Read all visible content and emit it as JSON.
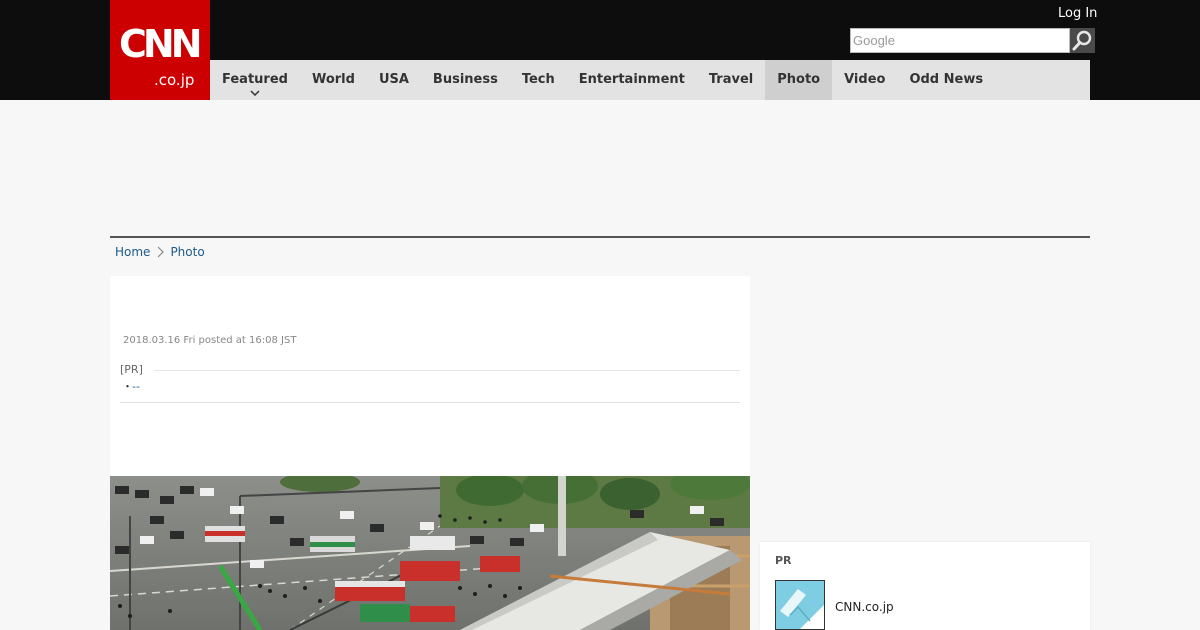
{
  "header": {
    "logo_main": "CNN",
    "logo_sub": ".co.jp",
    "login_label": "Log In",
    "search_placeholder": "Google"
  },
  "nav": {
    "items": [
      {
        "label": "Featured"
      },
      {
        "label": "World"
      },
      {
        "label": "USA"
      },
      {
        "label": "Business"
      },
      {
        "label": "Tech"
      },
      {
        "label": "Entertainment"
      },
      {
        "label": "Travel"
      },
      {
        "label": "Photo"
      },
      {
        "label": "Video"
      },
      {
        "label": "Odd News"
      }
    ],
    "active": "Photo"
  },
  "breadcrumb": {
    "home": "Home",
    "current": "Photo"
  },
  "article": {
    "timestamp": "2018.03.16 Fri posted at 16:08 JST",
    "pr_label": "[PR]",
    "pr_bullet": "・",
    "pr_link": "--"
  },
  "sidebar": {
    "heading": "PR",
    "link_text": "CNN.co.jp"
  },
  "icons": {
    "search": "search-icon",
    "breadcrumb_separator": "chevron-right-icon",
    "nav_caret": "chevron-down-icon"
  },
  "colors": {
    "brand_red": "#cc0000",
    "topbar": "#0d0d0d",
    "nav_bg": "#e3e3e3",
    "nav_active": "#cfcfcf",
    "link_blue": "#1d5a8a"
  }
}
